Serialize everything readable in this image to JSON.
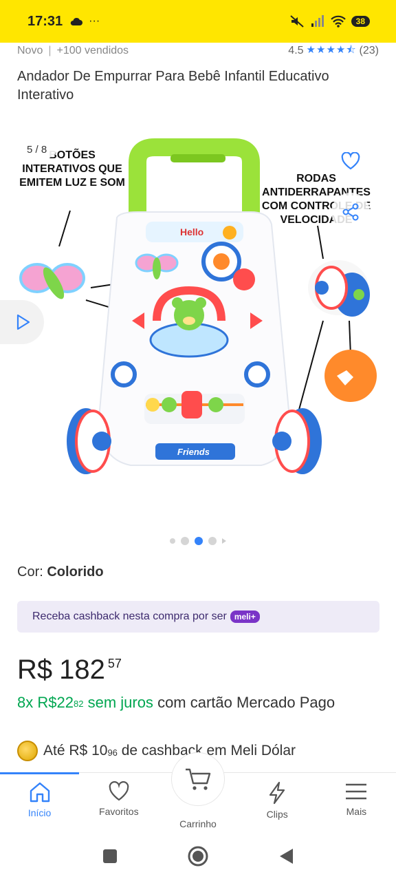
{
  "status_bar": {
    "time": "17:31",
    "battery": "38"
  },
  "product": {
    "condition": "Novo",
    "sold": "+100 vendidos",
    "rating": "4.5",
    "reviews": "(23)",
    "title": "Andador De Empurrar Para Bebê Infantil Educativo Interativo"
  },
  "gallery": {
    "counter": "5 / 8",
    "callout_left": "BOTÕES INTERATIVOS QUE EMITEM LUZ E SOM",
    "callout_right": "RODAS ANTIDERRAPANTES COM CONTROLE DE VELOCIDADE",
    "toy_label": "Friends",
    "toy_sign": "Hello"
  },
  "color": {
    "label": "Cor:",
    "value": "Colorido"
  },
  "cashback_banner": {
    "text": "Receba cashback nesta compra por ser",
    "badge": "meli+"
  },
  "price": {
    "currency": "R$",
    "integer": "182",
    "cents": "57"
  },
  "installments": {
    "count": "8x",
    "currency": "R$",
    "integer": "22",
    "cents": "82",
    "interest": "sem juros",
    "suffix": "com cartão Mercado Pago"
  },
  "meli_dolar": {
    "prefix": "Até",
    "currency": "R$",
    "integer": "10",
    "cents": "96",
    "suffix": "de cashback em Meli Dólar"
  },
  "nav": [
    {
      "label": "Início",
      "icon": "home-icon"
    },
    {
      "label": "Favoritos",
      "icon": "heart-icon"
    },
    {
      "label": "Carrinho",
      "icon": "cart-icon"
    },
    {
      "label": "Clips",
      "icon": "bolt-icon"
    },
    {
      "label": "Mais",
      "icon": "menu-icon"
    }
  ],
  "colors": {
    "brand_yellow": "#FFE600",
    "accent_blue": "#3483FA",
    "green": "#00A650",
    "meli_purple": "#7A34C7"
  }
}
